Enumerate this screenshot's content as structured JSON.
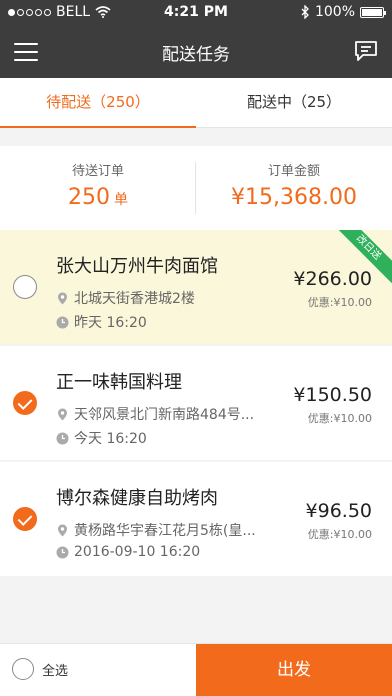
{
  "status_bar": {
    "carrier": "BELL",
    "time": "4:21 PM",
    "battery": "100%"
  },
  "header": {
    "title": "配送任务"
  },
  "tabs": [
    {
      "label": "待配送（250）",
      "active": true
    },
    {
      "label": "配送中（25）",
      "active": false
    }
  ],
  "summary": {
    "pending_label": "待送订单",
    "pending_count": "250",
    "pending_unit": "单",
    "amount_label": "订单金额",
    "amount_value": "¥15,368.00"
  },
  "orders": [
    {
      "name": "张大山万州牛肉面馆",
      "address": "北城天街香港城2楼",
      "time": "昨天 16:20",
      "price": "¥266.00",
      "discount": "优惠:¥10.00",
      "badge": "改日送",
      "checked": false,
      "highlighted": true
    },
    {
      "name": "正一味韩国料理",
      "address": "天邻风景北门新南路484号...",
      "time": "今天 16:20",
      "price": "¥150.50",
      "discount": "优惠:¥10.00",
      "checked": true
    },
    {
      "name": "博尔森健康自助烤肉",
      "address": "黄杨路华宇春江花月5栋(皇...",
      "time": "2016-09-10 16:20",
      "price": "¥96.50",
      "discount": "优惠:¥10.00",
      "checked": true
    }
  ],
  "footer": {
    "select_all_label": "全选",
    "depart_label": "出发"
  },
  "colors": {
    "accent": "#f26b1d",
    "header_bg": "#3d3d3d",
    "highlight_bg": "#fbf7da",
    "badge_green": "#2fb15c"
  },
  "icons": [
    "menu-icon",
    "message-icon",
    "location-icon",
    "clock-icon",
    "check-icon",
    "wifi-icon",
    "bluetooth-icon",
    "battery-icon"
  ]
}
